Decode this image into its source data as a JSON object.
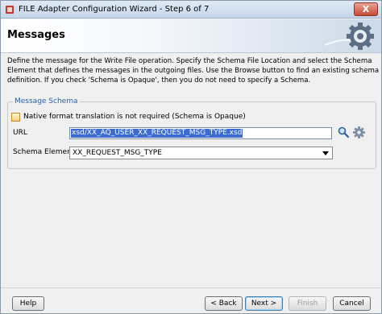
{
  "window": {
    "title": "FILE Adapter Configuration Wizard - Step 6 of 7",
    "close_label": "X"
  },
  "banner": {
    "heading": "Messages"
  },
  "description": "Define the message for the Write File operation.  Specify the Schema File Location and select the Schema Element that defines the messages in the outgoing files. Use the Browse button to find an existing schema definition. If you check 'Schema is Opaque', then you do not need to specify a Schema.",
  "schema_group": {
    "legend": "Message Schema",
    "native_checkbox": {
      "label": "Native format translation is not required (Schema is Opaque)",
      "checked": false
    },
    "url": {
      "label": "URL",
      "value": "xsd/XX_AQ_USER_XX_REQUEST_MSG_TYPE.xsd"
    },
    "schema_element": {
      "label": "Schema Element",
      "value": "XX_REQUEST_MSG_TYPE"
    }
  },
  "buttons": {
    "help": "Help",
    "back": "< Back",
    "next": "Next >",
    "finish": "Finish",
    "cancel": "Cancel"
  }
}
